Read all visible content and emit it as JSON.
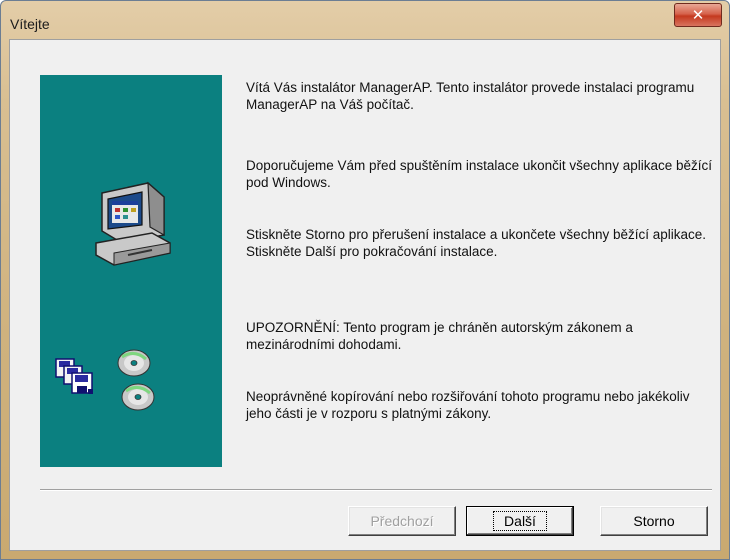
{
  "window": {
    "title": "Vítejte",
    "close_icon": "close-icon"
  },
  "left_panel": {
    "background": "#0b8080",
    "icons": [
      "computer-icon",
      "floppy-disks-icon",
      "cd-disc-icon"
    ]
  },
  "content": {
    "paragraphs": [
      "Vítá Vás instalátor  ManagerAP. Tento instalátor provede instalaci programu  ManagerAP na Váš počítač.",
      "Doporučujeme Vám  před spuštěním instalace ukončit všechny aplikace běžící pod Windows.",
      "Stiskněte Storno pro přerušení instalace a ukončete všechny běžící aplikace. Stiskněte Další pro pokračování instalace.",
      "UPOZORNĚNÍ: Tento program je chráněn autorským zákonem a mezinárodními dohodami.",
      "Neoprávněné kopírování nebo rozšiřování tohoto programu nebo jakékoliv jeho části je v rozporu s platnými zákony."
    ]
  },
  "buttons": {
    "back": {
      "label": "Předchozí",
      "enabled": false
    },
    "next": {
      "label": "Další",
      "enabled": true
    },
    "cancel": {
      "label": "Storno",
      "enabled": true
    }
  }
}
